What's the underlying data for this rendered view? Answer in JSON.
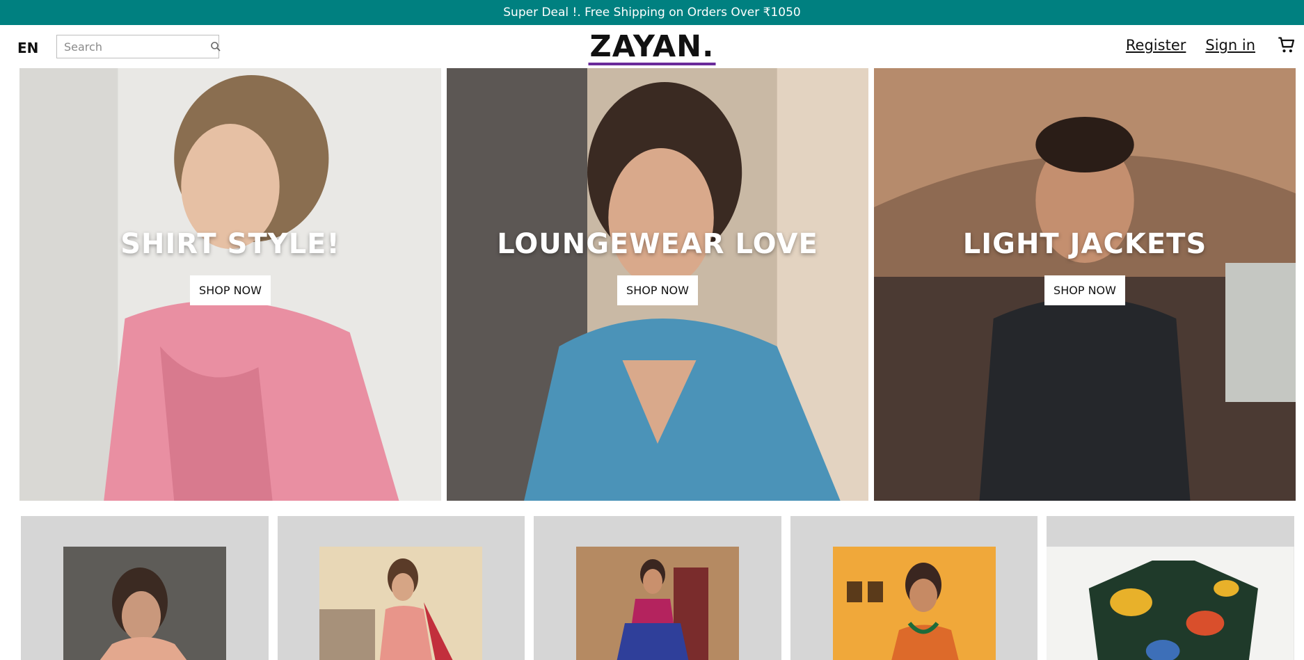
{
  "announcement": {
    "text": "Super Deal !. Free Shipping on Orders Over ₹1050"
  },
  "header": {
    "language": "EN",
    "search_placeholder": "Search",
    "logo": "ZAYAN.",
    "register_label": "Register",
    "signin_label": "Sign in"
  },
  "hero": {
    "panels": [
      {
        "title": "SHIRT STYLE!",
        "button": "SHOP NOW"
      },
      {
        "title": "LOUNGEWEAR LOVE",
        "button": "SHOP NOW"
      },
      {
        "title": "LIGHT JACKETS",
        "button": "SHOP NOW"
      }
    ]
  },
  "colors": {
    "accent": "#008080",
    "logo_underline": "#6a2b9a",
    "category_bg": "#d6d6d6"
  },
  "icons": {
    "search": "search-icon",
    "cart": "cart-icon"
  }
}
